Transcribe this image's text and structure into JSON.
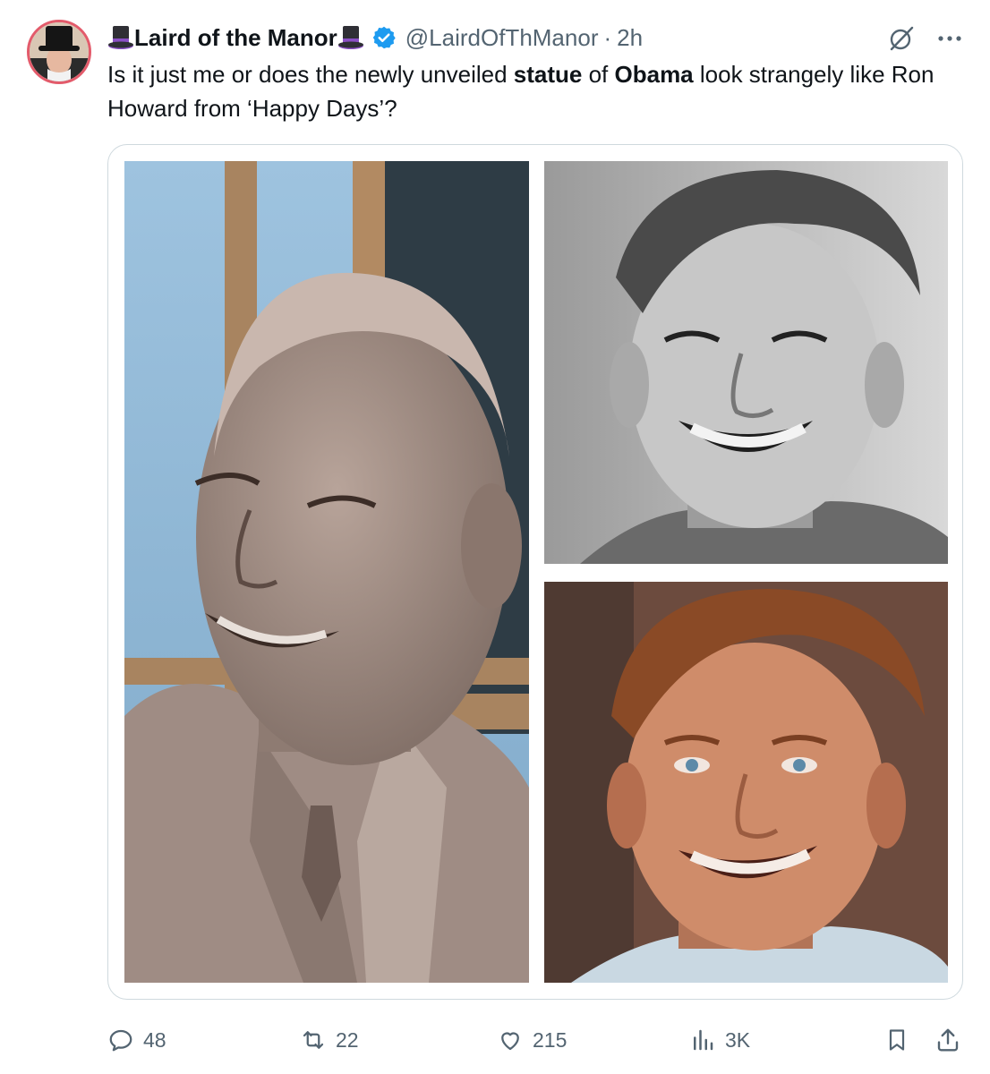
{
  "author": {
    "display_name": "Laird of the Manor",
    "handle": "@LairdOfThManor",
    "separator": "·",
    "timestamp": "2h",
    "verified": true,
    "name_emoji": "top-hat-icon"
  },
  "tweet": {
    "text_1": "Is it just me or does the newly unveiled ",
    "bold_1": "statue",
    "text_2": " of ",
    "bold_2": "Obama",
    "text_3": " look strangely like Ron Howard from ‘Happy Days’?"
  },
  "media": {
    "images": [
      "statue-photo",
      "black-and-white-portrait-photo",
      "color-portrait-photo"
    ]
  },
  "actions": {
    "replies": "48",
    "reposts": "22",
    "likes": "215",
    "views": "3K"
  },
  "colors": {
    "text": "#0f1419",
    "muted": "#536471",
    "verified_blue": "#1d9bf0",
    "border": "#cfd9de"
  }
}
